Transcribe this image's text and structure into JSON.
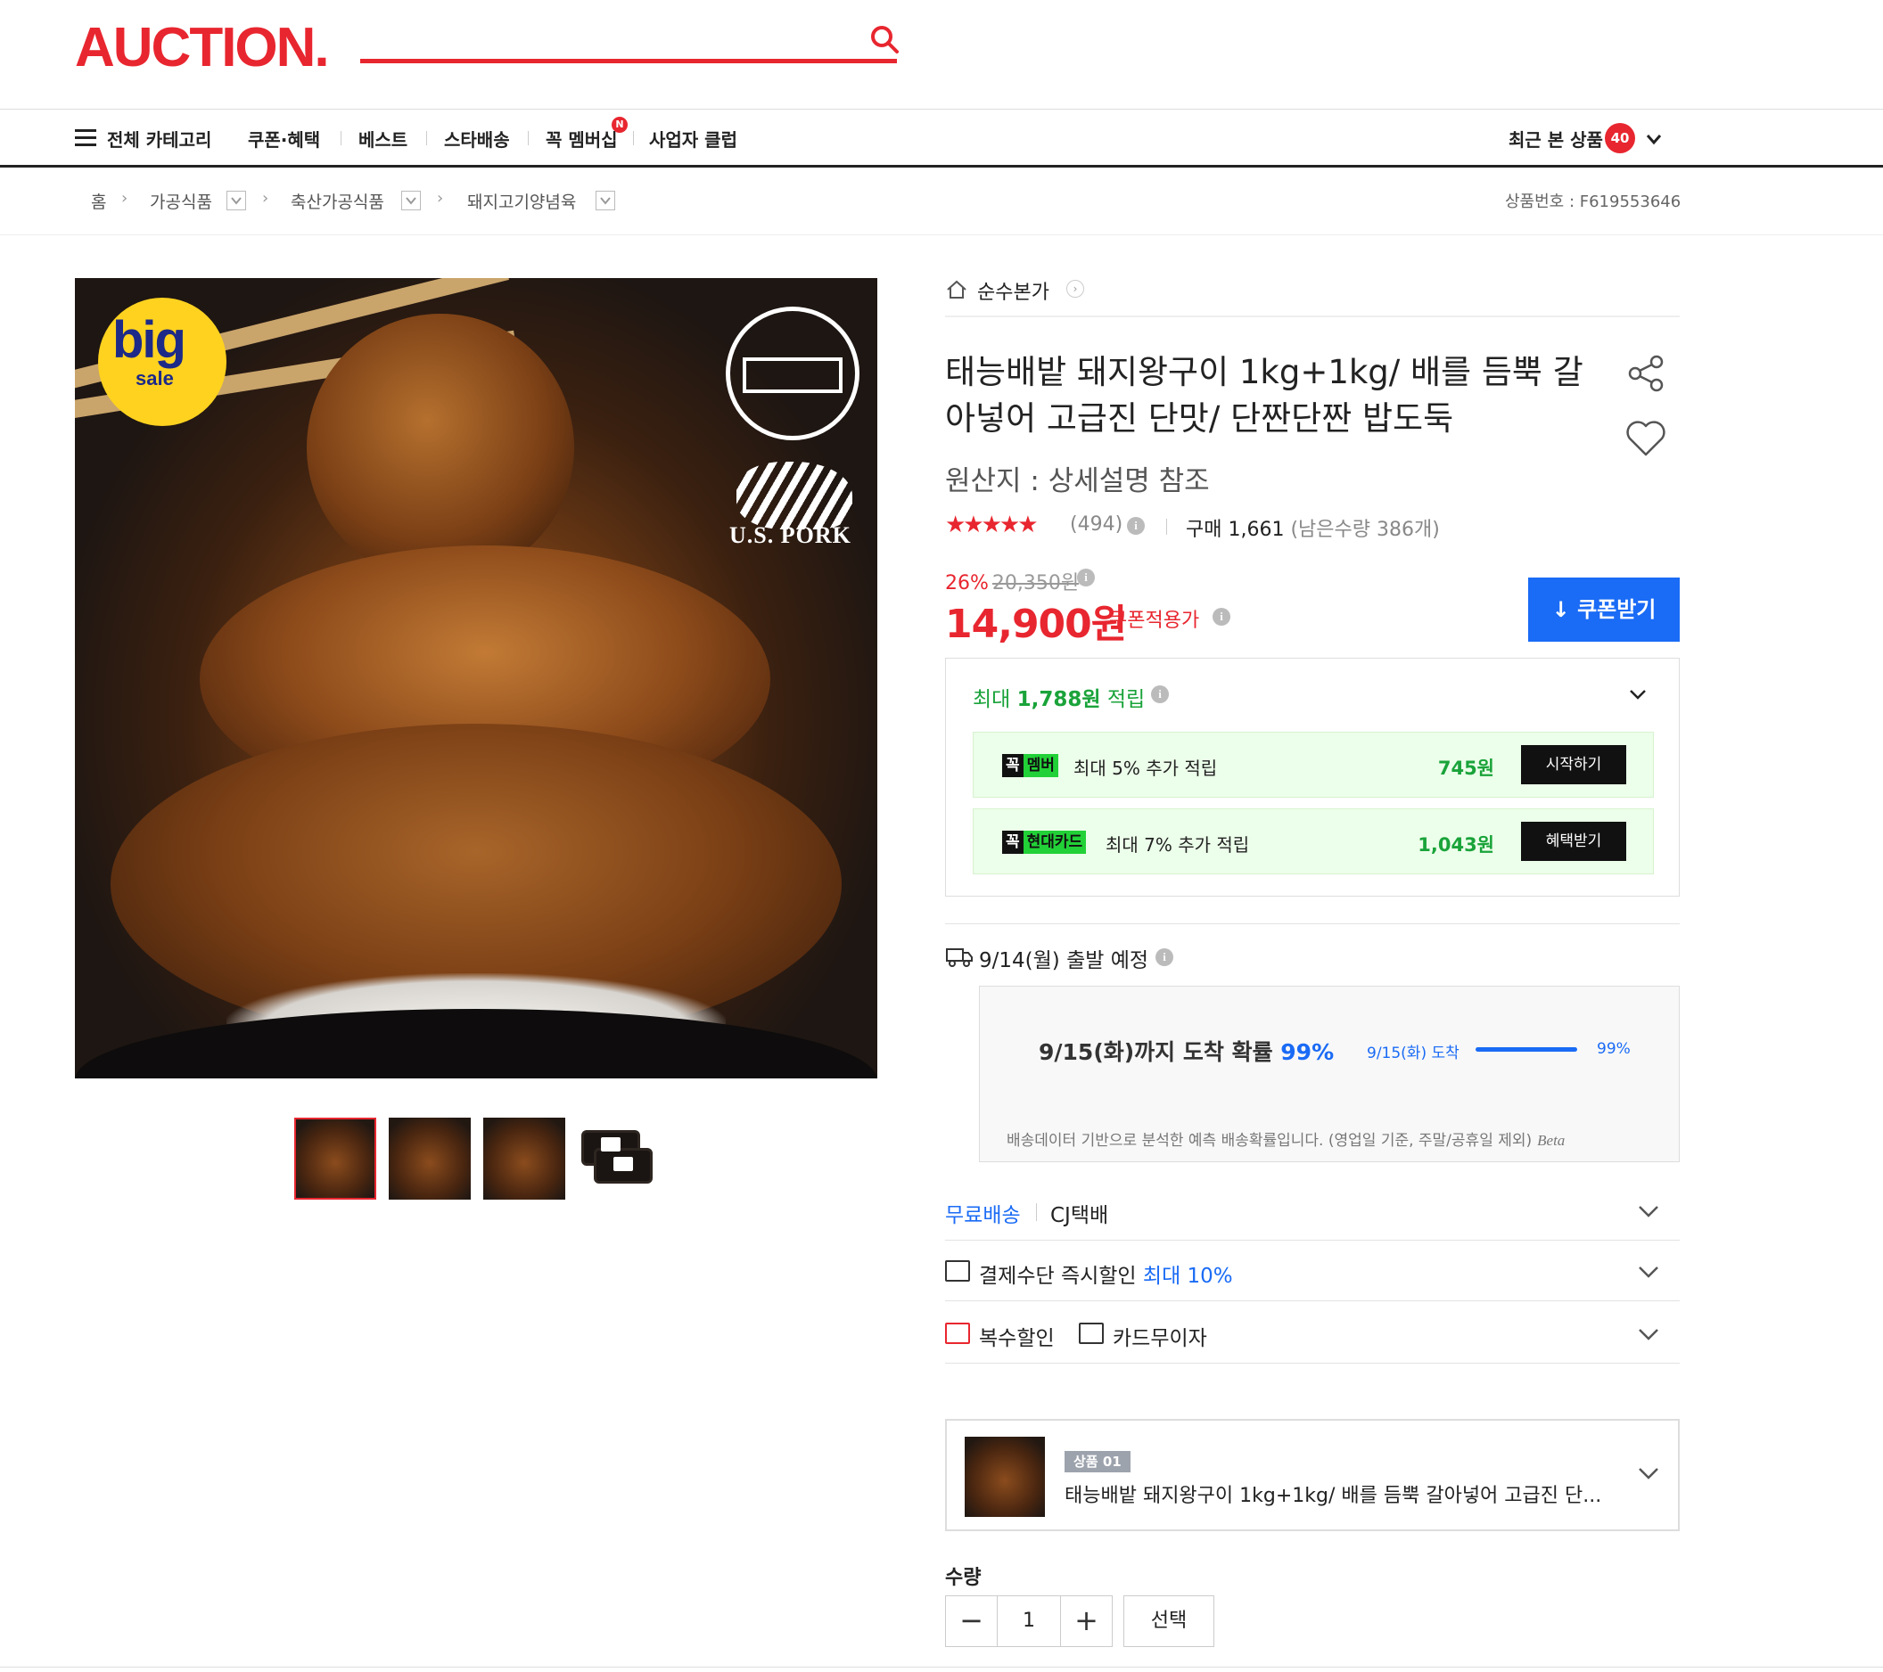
{
  "brand": {
    "logo": "AUCTION.",
    "accent": "#e8262f",
    "blue": "#1a6bf5",
    "green": "#1aa33a"
  },
  "nav": {
    "category": "전체 카테고리",
    "items": [
      "쿠폰·혜택",
      "베스트",
      "스타배송",
      "꼭 멤버십",
      "사업자 클럽"
    ],
    "membership_badge": "N",
    "recent_label": "최근 본 상품",
    "recent_count": "40"
  },
  "breadcrumb": {
    "home": "홈",
    "levels": [
      "가공식품",
      "축산가공식품",
      "돼지고기양념육"
    ],
    "product_no": "상품번호 : F619553646"
  },
  "image": {
    "badge_big": "big",
    "badge_sale": "sale",
    "logo_text": "U.S. PORK",
    "thumb_count": 4
  },
  "product": {
    "store": "순수본가",
    "title": "태능배밭 돼지왕구이 1kg+1kg/ 배를 듬뿍 갈아넣어 고급진 단맛/ 단짠단짠 밥도둑",
    "origin": "원산지 : 상세설명 참조",
    "stars": "★★★★★",
    "rating": 4.5,
    "review_count": "(494)",
    "purchase_label": "구매 1,661",
    "remaining": "(남은수량 386개)",
    "discount_pct": "26%",
    "original_price": "20,350원",
    "price": "14,900원",
    "coupon_applied": "쿠폰적용가",
    "coupon_button": "쿠폰받기"
  },
  "reward": {
    "head_prefix": "최대 ",
    "head_amount": "1,788원",
    "head_suffix": " 적립",
    "rows": [
      {
        "badge_k": "꼭",
        "badge_g": "멤버",
        "desc": "최대 5% 추가 적립",
        "amount": "745원",
        "button": "시작하기"
      },
      {
        "badge_k": "꼭",
        "badge_g": "현대카드",
        "desc": "최대 7% 추가 적립",
        "amount": "1,043원",
        "button": "혜택받기"
      }
    ]
  },
  "shipping": {
    "depart": "9/14(월) 출발 예정",
    "prob_text": "9/15(화)까지 도착 확률 ",
    "prob_pct": "99%",
    "prob_label": "9/15(화) 도착",
    "prob_value": "99%",
    "prob_fraction": 0.99,
    "note": "배송데이터 기반으로 분석한 예측 배송확률입니다. (영업일 기준, 주말/공휴일 제외)",
    "beta": "Beta"
  },
  "options": {
    "free_ship": "무료배송",
    "carrier": "CJ택배",
    "pay_discount": "결제수단 즉시할인 ",
    "pay_discount_max": "최대 10%",
    "multi_discount": "복수할인",
    "card_installment": "카드무이자"
  },
  "selection": {
    "badge": "상품 01",
    "name": "태능배밭 돼지왕구이 1kg+1kg/ 배를 듬뿍 갈아넣어 고급진 단...",
    "qty_label": "수량",
    "qty_minus": "−",
    "qty_value": "1",
    "qty_plus": "+",
    "select_button": "선택"
  }
}
